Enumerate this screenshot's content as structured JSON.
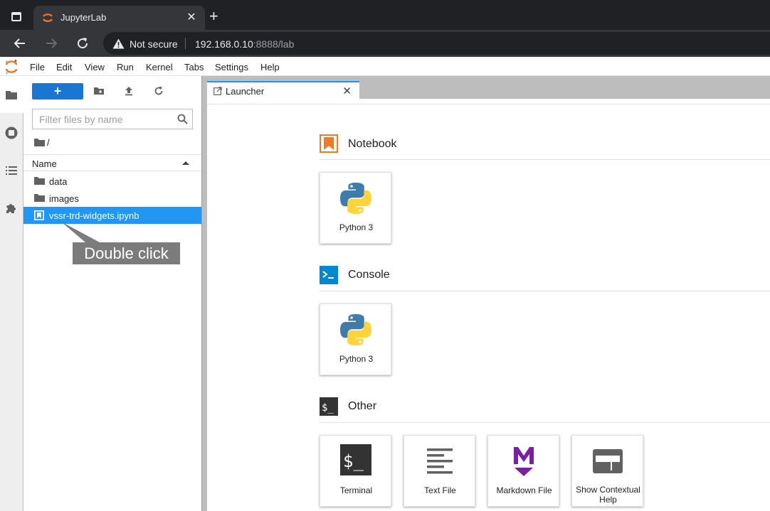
{
  "browser": {
    "tab_title": "JupyterLab",
    "not_secure": "Not secure",
    "url_host": "192.168.0.10",
    "url_path": ":8888/lab"
  },
  "menu": [
    "File",
    "Edit",
    "View",
    "Run",
    "Kernel",
    "Tabs",
    "Settings",
    "Help"
  ],
  "filebrowser": {
    "new_label": "+",
    "filter_placeholder": "Filter files by name",
    "breadcrumb": "/",
    "column_name": "Name",
    "files": [
      {
        "name": "data",
        "type": "folder",
        "selected": false
      },
      {
        "name": "images",
        "type": "folder",
        "selected": false
      },
      {
        "name": "vssr-trd-widgets.ipynb",
        "type": "notebook",
        "selected": true
      }
    ]
  },
  "annotation": "Double click",
  "dock": {
    "tab_label": "Launcher"
  },
  "launcher": {
    "sections": [
      {
        "title": "Notebook",
        "cards": [
          {
            "label": "Python 3",
            "icon": "python-icon"
          }
        ]
      },
      {
        "title": "Console",
        "cards": [
          {
            "label": "Python 3",
            "icon": "python-icon"
          }
        ]
      },
      {
        "title": "Other",
        "cards": [
          {
            "label": "Terminal",
            "icon": "terminal-icon"
          },
          {
            "label": "Text File",
            "icon": "text-file-icon"
          },
          {
            "label": "Markdown File",
            "icon": "markdown-icon"
          },
          {
            "label": "Show Contextual Help",
            "icon": "contextual-help-icon"
          }
        ]
      }
    ]
  },
  "colors": {
    "accent": "#2196f3",
    "jupyter_orange": "#f37726",
    "python_blue": "#3f7cac",
    "python_yellow": "#ffd43b",
    "markdown_purple": "#7b1fa2"
  }
}
